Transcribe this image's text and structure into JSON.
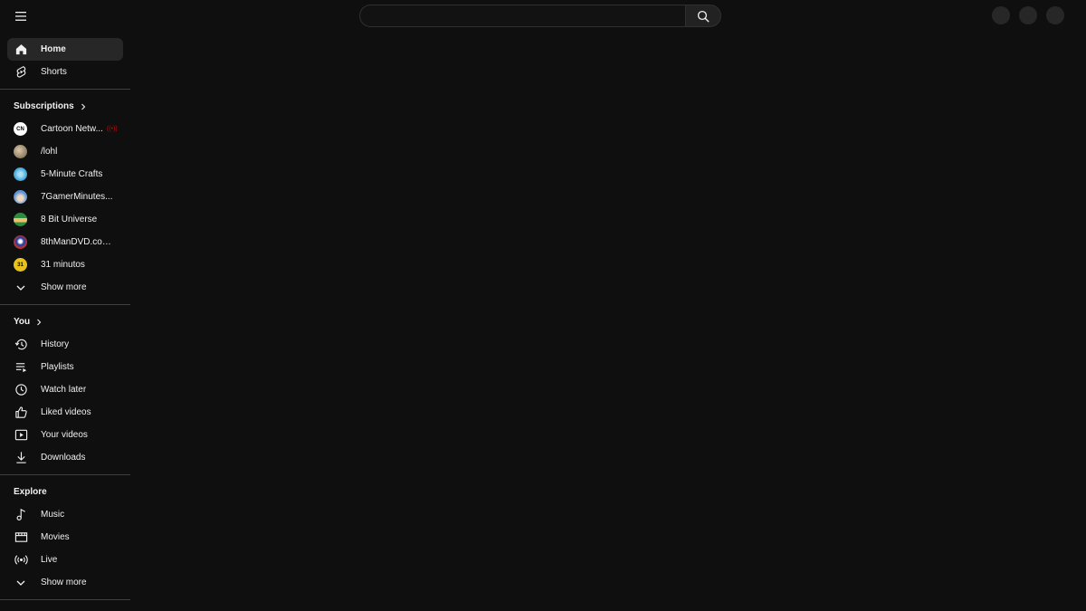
{
  "search": {
    "placeholder": ""
  },
  "sidebar": {
    "main": [
      {
        "label": "Home",
        "icon": "home-icon",
        "active": true
      },
      {
        "label": "Shorts",
        "icon": "shorts-icon",
        "active": false
      }
    ],
    "subscriptions": {
      "title": "Subscriptions",
      "items": [
        {
          "label": "Cartoon Netw...",
          "avatar_text": "CN",
          "avatar_color": "#ffffff",
          "live": true
        },
        {
          "label": "/lohl",
          "avatar_text": "",
          "avatar_color": "#b8a58a",
          "live": false
        },
        {
          "label": "5-Minute Crafts",
          "avatar_text": "",
          "avatar_color": "#4fb3e8",
          "live": false
        },
        {
          "label": "7GamerMinutes...",
          "avatar_text": "",
          "avatar_color": "#6aa6e0",
          "live": false
        },
        {
          "label": "8 Bit Universe",
          "avatar_text": "",
          "avatar_color": "#3c9a4a",
          "live": false
        },
        {
          "label": "8thManDVD.com...",
          "avatar_text": "",
          "avatar_color": "#c4302b",
          "live": false
        },
        {
          "label": "31 minutos",
          "avatar_text": "31",
          "avatar_color": "#e8c21c",
          "live": false
        }
      ],
      "show_more": "Show more"
    },
    "you": {
      "title": "You",
      "items": [
        {
          "label": "History",
          "icon": "history-icon"
        },
        {
          "label": "Playlists",
          "icon": "playlists-icon"
        },
        {
          "label": "Watch later",
          "icon": "watch-later-icon"
        },
        {
          "label": "Liked videos",
          "icon": "liked-icon"
        },
        {
          "label": "Your videos",
          "icon": "your-videos-icon"
        },
        {
          "label": "Downloads",
          "icon": "download-icon"
        }
      ]
    },
    "explore": {
      "title": "Explore",
      "items": [
        {
          "label": "Music",
          "icon": "music-icon"
        },
        {
          "label": "Movies",
          "icon": "movies-icon"
        },
        {
          "label": "Live",
          "icon": "live-icon"
        }
      ],
      "show_more": "Show more"
    }
  },
  "colors": {
    "background": "#0f0f0f",
    "active_item": "#272727",
    "divider": "#3f3f3f",
    "live_red": "#cc0000"
  }
}
